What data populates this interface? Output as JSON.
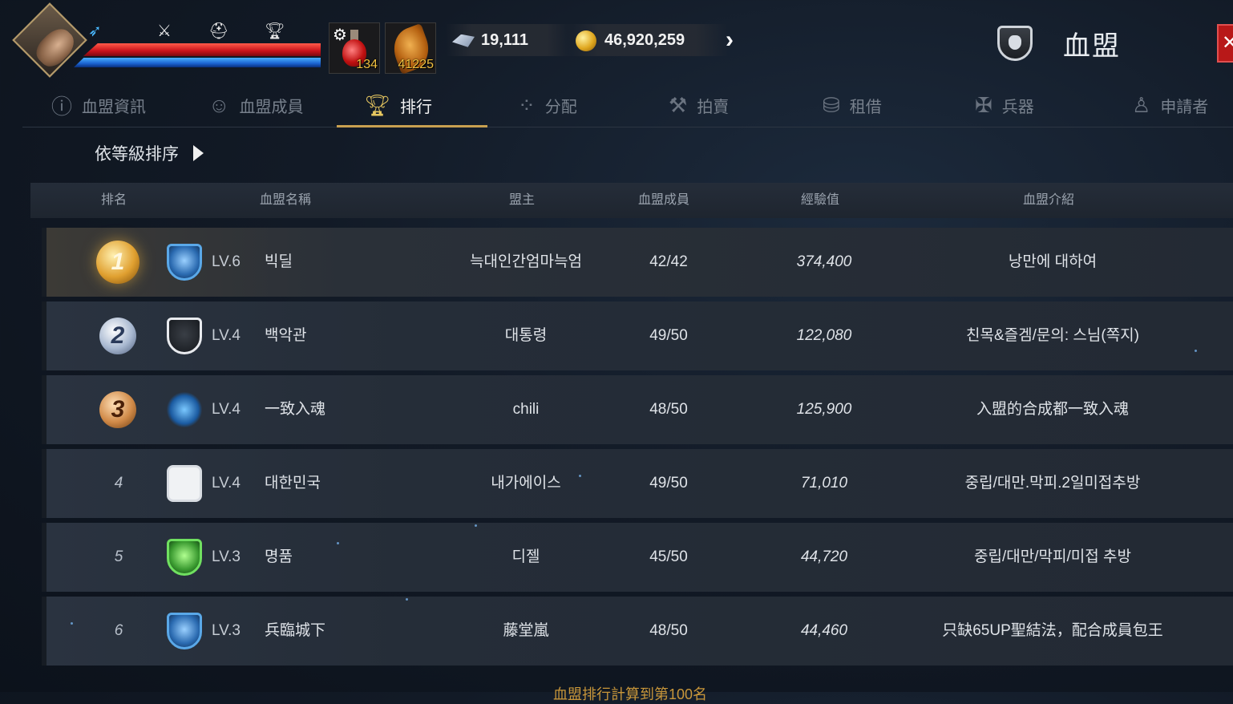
{
  "hud": {
    "buff_icons": [
      "wing-boost-icon",
      "sword-icon",
      "helmet-icon",
      "trophy-icon"
    ],
    "hp_color": "#e0202a",
    "mp_color": "#2a78e0",
    "potion_count": "134",
    "feather_count": "41225",
    "crystals": "19,111",
    "gold": "46,920,259"
  },
  "header": {
    "title": "血盟",
    "close_label": "✕"
  },
  "tabs": [
    {
      "label": "血盟資訊",
      "icon": "info-shield-icon",
      "active": false
    },
    {
      "label": "血盟成員",
      "icon": "members-icon",
      "active": false
    },
    {
      "label": "排行",
      "icon": "trophy-icon",
      "active": true
    },
    {
      "label": "分配",
      "icon": "distribute-icon",
      "active": false
    },
    {
      "label": "拍賣",
      "icon": "auction-hammer-icon",
      "active": false
    },
    {
      "label": "租借",
      "icon": "coins-icon",
      "active": false
    },
    {
      "label": "兵器",
      "icon": "weapon-icon",
      "active": false
    },
    {
      "label": "申請者",
      "icon": "applicant-icon",
      "active": false
    }
  ],
  "sort": {
    "label": "依等級排序"
  },
  "table": {
    "headers": [
      "排名",
      "血盟名稱",
      "盟主",
      "血盟成員",
      "經驗值",
      "血盟介紹"
    ],
    "rows": [
      {
        "rank": "1",
        "level": "LV.6",
        "name": "빅딜",
        "leader": "늑대인간엄마늑엄",
        "members": "42/42",
        "exp": "374,400",
        "intro": "낭만에 대하여"
      },
      {
        "rank": "2",
        "level": "LV.4",
        "name": "백악관",
        "leader": "대통령",
        "members": "49/50",
        "exp": "122,080",
        "intro": "친목&즐겜/문의: 스님(쪽지)"
      },
      {
        "rank": "3",
        "level": "LV.4",
        "name": "一致入魂",
        "leader": "chili",
        "members": "48/50",
        "exp": "125,900",
        "intro": "入盟的合成都一致入魂"
      },
      {
        "rank": "4",
        "level": "LV.4",
        "name": "대한민국",
        "leader": "내가에이스",
        "members": "49/50",
        "exp": "71,010",
        "intro": "중립/대만.막피.2일미접추방"
      },
      {
        "rank": "5",
        "level": "LV.3",
        "name": "명품",
        "leader": "디젤",
        "members": "45/50",
        "exp": "44,720",
        "intro": "중립/대만/막피/미접 추방"
      },
      {
        "rank": "6",
        "level": "LV.3",
        "name": "兵臨城下",
        "leader": "藤堂嵐",
        "members": "48/50",
        "exp": "44,460",
        "intro": "只缺65UP聖結法，配合成員包王"
      }
    ]
  },
  "footer": {
    "note": "血盟排行計算到第100名"
  }
}
